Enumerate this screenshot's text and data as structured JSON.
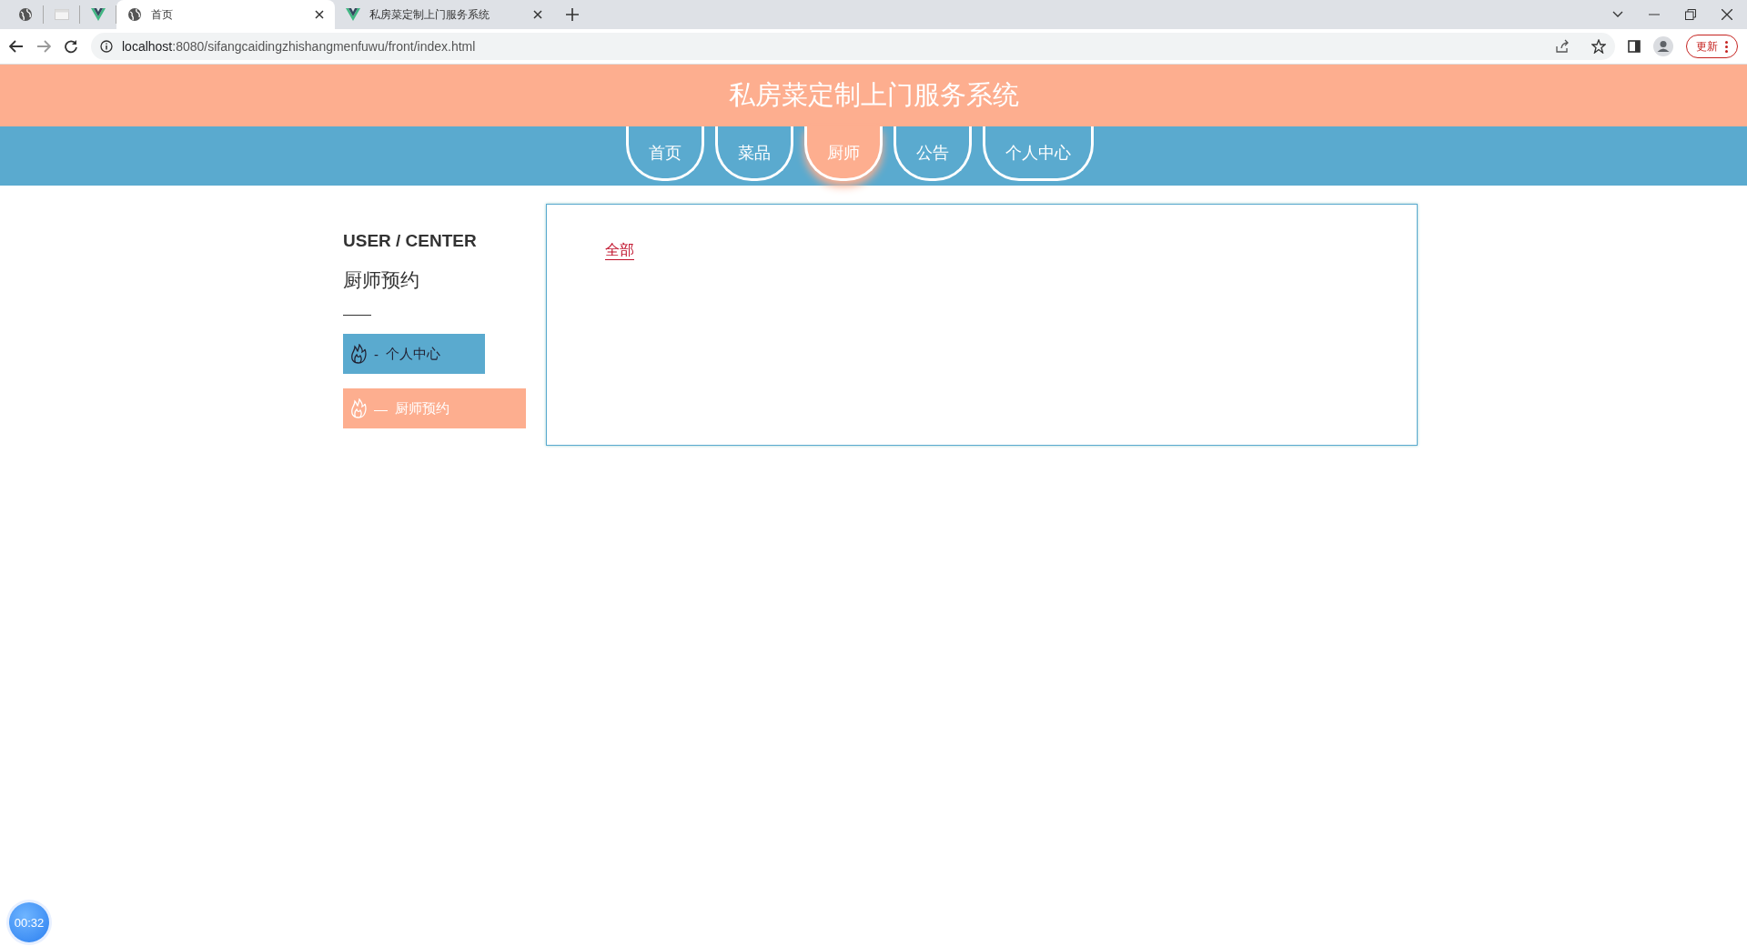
{
  "browser": {
    "tabs": [
      {
        "kind": "pinned",
        "selected": false
      },
      {
        "kind": "pinned",
        "selected": false
      },
      {
        "kind": "pinned",
        "selected": false
      },
      {
        "kind": "tab",
        "title": "首页",
        "selected": true
      },
      {
        "kind": "tab",
        "title": "私房菜定制上门服务系统",
        "selected": false
      }
    ],
    "url_host": "localhost",
    "url_rest": ":8080/sifangcaidingzhishangmenfuwu/front/index.html",
    "update_button": "更新"
  },
  "header": {
    "title": "私房菜定制上门服务系统"
  },
  "nav": [
    {
      "label": "首页",
      "selected": false
    },
    {
      "label": "菜品",
      "selected": false
    },
    {
      "label": "厨师",
      "selected": true
    },
    {
      "label": "公告",
      "selected": false
    },
    {
      "label": "个人中心",
      "selected": false
    }
  ],
  "sidebar": {
    "heading": "USER / CENTER",
    "subtitle": "厨师预约",
    "items": [
      {
        "prefix": "-",
        "label": "个人中心",
        "selected": false
      },
      {
        "prefix": "—",
        "label": "厨师预约",
        "selected": true
      }
    ]
  },
  "content": {
    "filters": [
      {
        "label": "全部",
        "selected": true
      }
    ]
  },
  "timer": "00:32"
}
